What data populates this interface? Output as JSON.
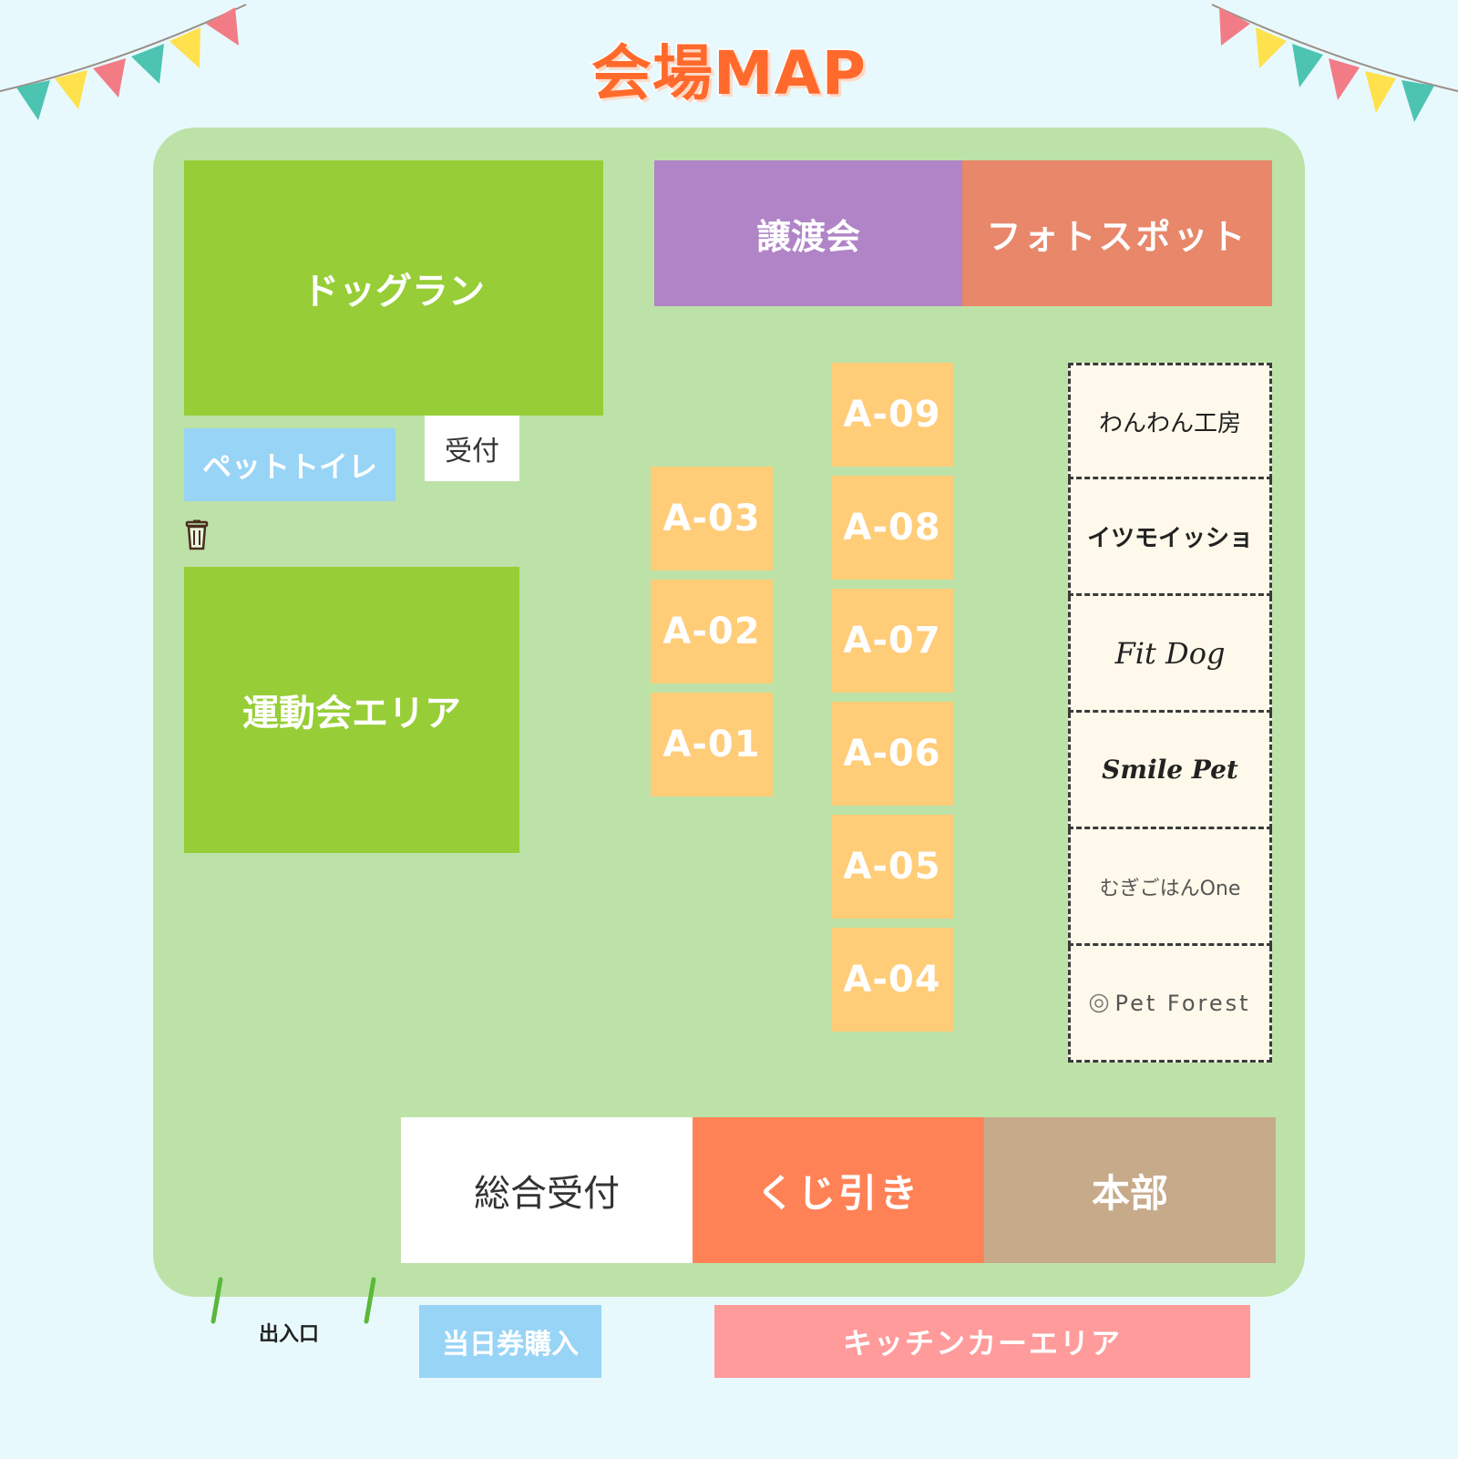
{
  "title": "会場MAP",
  "areas": {
    "dog_run": "ドッグラン",
    "pet_toilet": "ペットトイレ",
    "reception_small": "受付",
    "sports_area": "運動会エリア",
    "adoption": "譲渡会",
    "photo_spot": "フォトスポット",
    "general_reception": "総合受付",
    "lottery": "くじ引き",
    "headquarters": "本部",
    "entrance": "出入口",
    "same_day_ticket": "当日券購入",
    "kitchen_car": "キッチンカーエリア"
  },
  "booths_left": [
    "A-03",
    "A-02",
    "A-01"
  ],
  "booths_right": [
    "A-09",
    "A-08",
    "A-07",
    "A-06",
    "A-05",
    "A-04"
  ],
  "shops": [
    "わんわん工房",
    "イツモイッショ",
    "Fit Dog",
    "Smile Pet",
    "むぎごはんOne",
    "Pet Forest"
  ],
  "icons": {
    "trash": "trash-icon",
    "bunting": "bunting-icon"
  },
  "colors": {
    "background": "#e8f9fd",
    "venue": "#bde2a8",
    "green_zone": "#97cd36",
    "booth": "#ffcc78",
    "adoption": "#b084c6",
    "photo_spot": "#e8876a",
    "lottery": "#ff8257",
    "headquarters": "#c6aa8a",
    "pet_toilet": "#98d4f6",
    "kitchen_car": "#ff9b9b",
    "title": "#ff6a2c"
  }
}
